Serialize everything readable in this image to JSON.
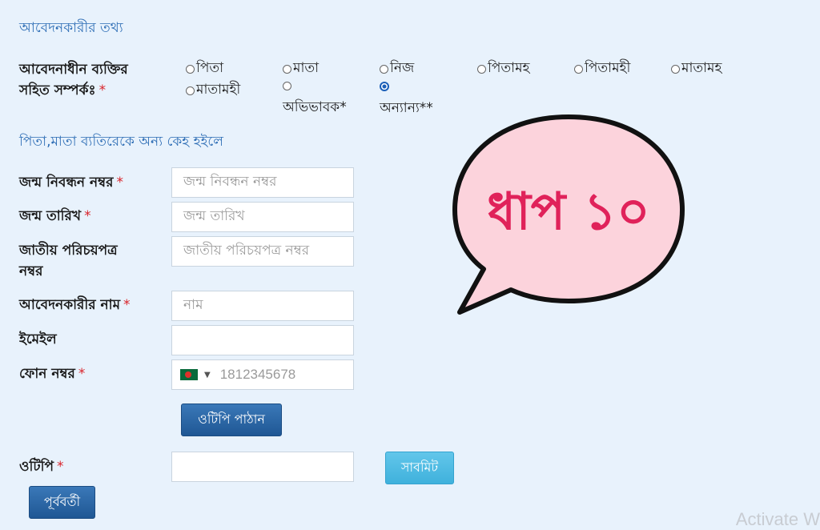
{
  "sections": {
    "applicant_info": "আবেদনকারীর তথ্য",
    "other_person": "পিতা,মাতা ব্যতিরেকে অন্য কেহ হইলে"
  },
  "relation": {
    "label_line1": "আবেদনাধীন ব্যক্তির",
    "label_line2": "সহিত সম্পর্কঃ",
    "required_mark": "*",
    "options": [
      "পিতা",
      "মাতা",
      "নিজ",
      "পিতামহ",
      "পিতামহী",
      "মাতামহ",
      "মাতামহী",
      "অভিভাবক*",
      "অন্যান্য**"
    ],
    "selected": "অন্যান্য**"
  },
  "fields": {
    "birth_reg": {
      "label": "জন্ম নিবন্ধন নম্বর",
      "placeholder": "জন্ম নিবন্ধন নম্বর",
      "required": "*"
    },
    "birth_date": {
      "label": "জন্ম তারিখ",
      "placeholder": "জন্ম তারিখ",
      "required": "*"
    },
    "nid_line1": "জাতীয় পরিচয়পত্র",
    "nid_line2": "নম্বর",
    "nid_placeholder": "জাতীয় পরিচয়পত্র নম্বর",
    "applicant_name": {
      "label": "আবেদনকারীর নাম",
      "placeholder": "নাম",
      "required": "*"
    },
    "email": {
      "label": "ইমেইল",
      "placeholder": ""
    },
    "phone": {
      "label": "ফোন নম্বর",
      "placeholder": "1812345678",
      "required": "*",
      "country": "Bangladesh"
    },
    "otp": {
      "label": "ওটিপি",
      "required": "*",
      "value": ""
    }
  },
  "buttons": {
    "send_otp": "ওটিপি পাঠান",
    "submit": "সাবমিট",
    "previous": "পূর্ববর্তী"
  },
  "overlay": {
    "step_text": "ধাপ ১০",
    "bubble_fill": "#fcd3dc",
    "text_color": "#e0225a"
  },
  "watermark": "Activate W",
  "colors": {
    "background": "#e8f2fc",
    "section_title": "#2d6db5",
    "required": "#d9232a",
    "primary_button": "#1f5794",
    "submit_button": "#3fb1dc"
  }
}
